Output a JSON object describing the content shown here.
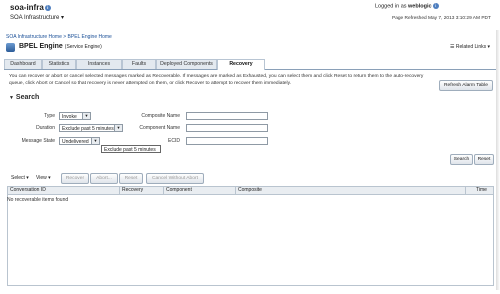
{
  "app": {
    "name": "soa-infra",
    "info_glyph": "i",
    "sub": "SOA Infrastructure ▾"
  },
  "session": {
    "logged_in": "Logged in as",
    "user": "weblogic",
    "refreshed": "Page Refreshed May 7, 2013 3:10:29 AM PDT"
  },
  "breadcrumb": "SOA Infrastructure Home > BPEL Engine Home",
  "page": {
    "title": "BPEL Engine",
    "subtitle": "(Service Engine)",
    "related": "Related Links ▾"
  },
  "tabs": [
    "Dashboard",
    "Statistics",
    "Instances",
    "Faults",
    "Deployed Components",
    "Recovery"
  ],
  "active_tab": "Recovery",
  "message_line1": "You can recover or abort or cancel selected messages marked as Recoverable. If messages are marked as Exhausted, you can select them and click Reset to return them to the auto-recovery",
  "message_line2": "queue, click Abort or Cancel so that recovery is never attempted on them, or click Recover to attempt to recover them immediately.",
  "refresh_alarm_button": "Refresh Alarm Table",
  "search": {
    "header": "Search",
    "type_label": "Type",
    "type_value": "Invoke",
    "duration_label": "Duration",
    "duration_value": "Exclude past 5 minutes",
    "message_state_label": "Message State",
    "message_state_value": "Undelivered",
    "composite_name_label": "Composite Name",
    "component_name_label": "Component Name",
    "ecid_label": "ECID",
    "tooltip": "Exclude past 5 minutes",
    "search_button": "Search",
    "reset_button": "Reset"
  },
  "toolbar": {
    "select": "Select ▾",
    "view": "View ▾",
    "recover": "Recover",
    "abort": "Abort...",
    "reset": "Reset",
    "cancel": "Cancel Without Abort"
  },
  "table": {
    "columns": [
      "Conversation ID",
      "Recovery",
      "Component",
      "Composite",
      "Time"
    ],
    "empty": "No recoverable items found"
  },
  "colors": {
    "accent": "#1a4f97",
    "tab_bg": "#e3e9ef",
    "border": "#b9c4cf"
  }
}
